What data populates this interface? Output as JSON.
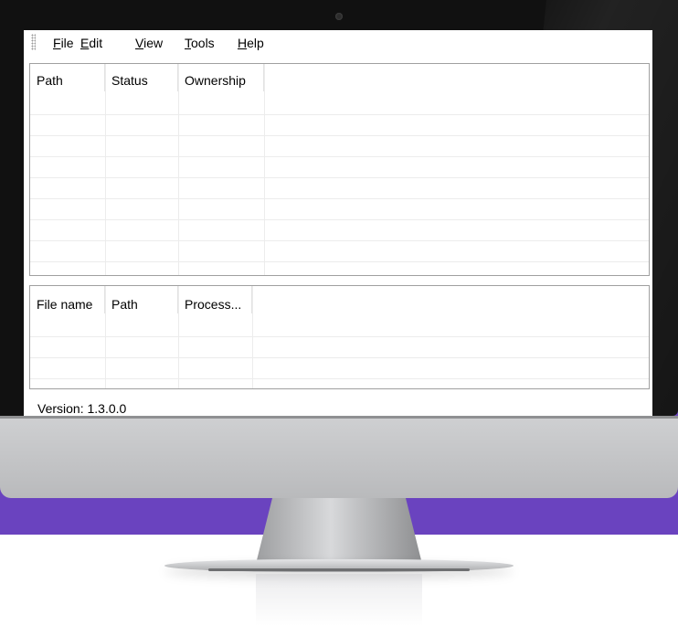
{
  "menu": {
    "items": [
      {
        "mnemonic": "F",
        "rest": "ile"
      },
      {
        "mnemonic": "E",
        "rest": "dit"
      },
      {
        "mnemonic": "V",
        "rest": "iew"
      },
      {
        "mnemonic": "T",
        "rest": "ools"
      },
      {
        "mnemonic": "H",
        "rest": "elp"
      }
    ]
  },
  "locks_table": {
    "columns": [
      "Path",
      "Status",
      "Ownership"
    ],
    "rows": []
  },
  "files_table": {
    "columns": [
      "File name",
      "Path",
      "Process..."
    ],
    "rows": []
  },
  "status_bar": {
    "version": "Version: 1.3.0.0"
  },
  "colors": {
    "background": "#6a43bf",
    "bezel": "#111111",
    "chin": "#c4c5c7"
  }
}
